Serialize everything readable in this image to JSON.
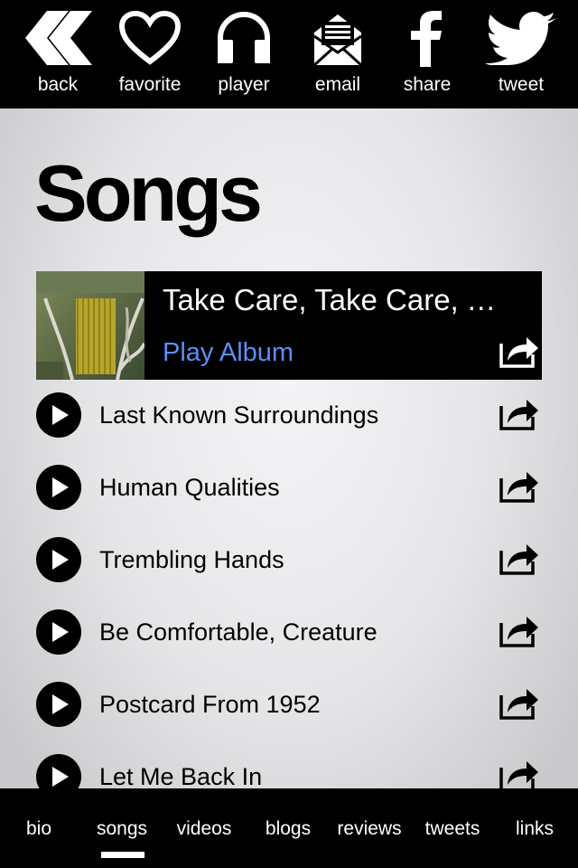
{
  "toolbar": {
    "back_label": "back",
    "favorite_label": "favorite",
    "player_label": "player",
    "email_label": "email",
    "share_label": "share",
    "tweet_label": "tweet"
  },
  "page": {
    "title": "Songs"
  },
  "album": {
    "title": "Take Care, Take Care, Take Care",
    "play_label": "Play Album",
    "art_icon": "album-cover-door"
  },
  "songs": [
    {
      "title": "Last Known Surroundings"
    },
    {
      "title": "Human Qualities"
    },
    {
      "title": "Trembling Hands"
    },
    {
      "title": "Be Comfortable, Creature"
    },
    {
      "title": "Postcard From 1952"
    },
    {
      "title": "Let Me Back In"
    }
  ],
  "tabs": [
    {
      "label": "bio"
    },
    {
      "label": "songs",
      "selected": true
    },
    {
      "label": "videos"
    },
    {
      "label": "blogs"
    },
    {
      "label": "reviews"
    },
    {
      "label": "tweets"
    },
    {
      "label": "links"
    }
  ],
  "colors": {
    "accent": "#5b8ff9",
    "bar_background": "#000000",
    "content_background": "#e6e6e8"
  }
}
